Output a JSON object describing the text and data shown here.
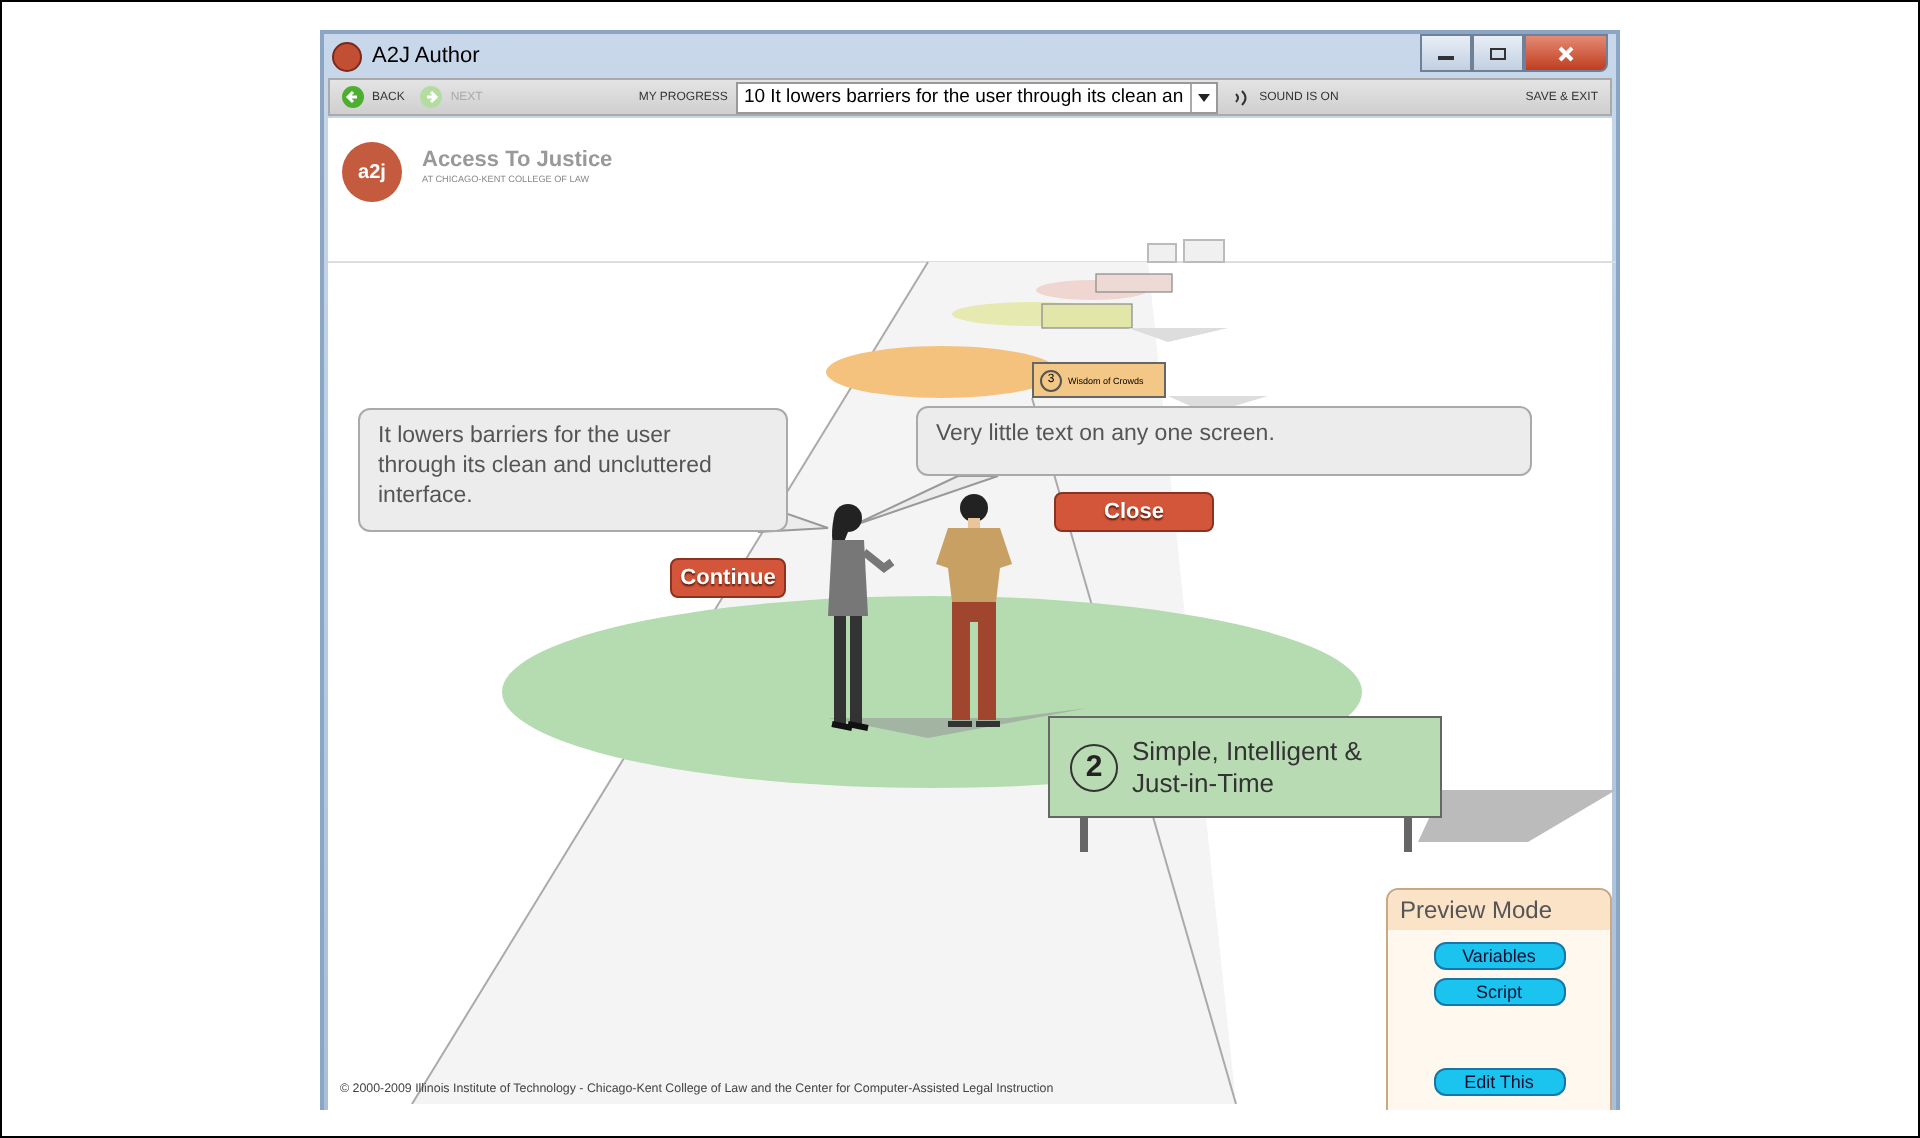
{
  "window": {
    "title": "A2J Author"
  },
  "toolbar": {
    "back": {
      "label": "BACK",
      "disabled": false
    },
    "next": {
      "label": "NEXT",
      "disabled": true
    },
    "progress_label": "MY PROGRESS",
    "progress_value": "10 It lowers barriers for the user through its clean an",
    "sound": "SOUND IS ON",
    "save_exit": "SAVE & EXIT"
  },
  "header": {
    "logo": "a2j",
    "title": "Access To Justice",
    "subtitle": "AT CHICAGO-KENT COLLEGE OF LAW"
  },
  "bubbles": [
    {
      "text": "It lowers barriers for the user through its clean and uncluttered interface."
    },
    {
      "text": "Very little text on any one screen."
    }
  ],
  "buttons": [
    {
      "label": "Continue"
    },
    {
      "label": "Close"
    }
  ],
  "signs": [
    {
      "number": "3",
      "label": "Wisdom of Crowds",
      "kind": "far"
    },
    {
      "number": "2",
      "label": "Simple, Intelligent & Just-in-Time",
      "kind": "near"
    }
  ],
  "preview_panel": {
    "title": "Preview Mode",
    "buttons": [
      "Variables",
      "Script",
      "Edit This"
    ]
  },
  "footer": "© 2000-2009 Illinois Institute of Technology - Chicago-Kent College of Law and the Center for Computer-Assisted Legal Instruction"
}
